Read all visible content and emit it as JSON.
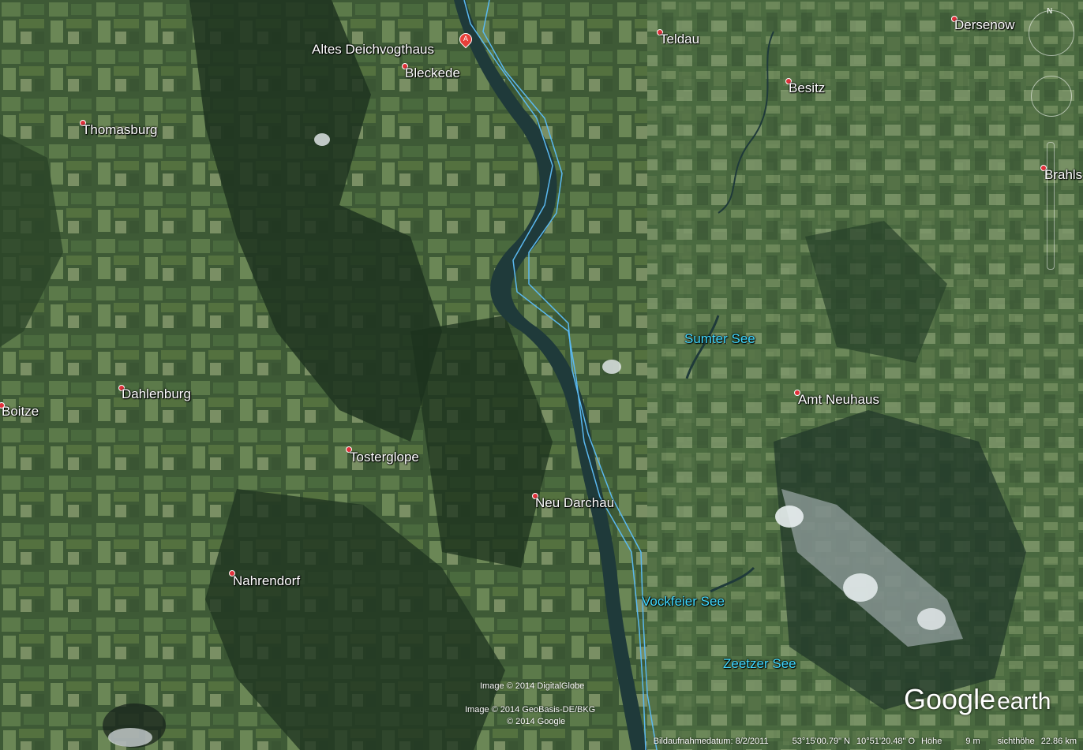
{
  "places": [
    {
      "id": "altes-deichvogthaus",
      "name": "Altes Deichvogthaus"
    },
    {
      "id": "bleckede",
      "name": "Bleckede"
    },
    {
      "id": "teldau",
      "name": "Teldau"
    },
    {
      "id": "dersenow",
      "name": "Dersenow"
    },
    {
      "id": "besitz",
      "name": "Besitz"
    },
    {
      "id": "thomasburg",
      "name": "Thomasburg"
    },
    {
      "id": "brahlstorf",
      "name": "Brahls"
    },
    {
      "id": "sumter-see",
      "name": "Sumter See"
    },
    {
      "id": "dahlenburg",
      "name": "Dahlenburg"
    },
    {
      "id": "boitze",
      "name": "Boitze"
    },
    {
      "id": "amt-neuhaus",
      "name": "Amt Neuhaus"
    },
    {
      "id": "tosterglope",
      "name": "Tosterglope"
    },
    {
      "id": "neu-darchau",
      "name": "Neu Darchau"
    },
    {
      "id": "nahrendorf",
      "name": "Nahrendorf"
    },
    {
      "id": "vockfeier-see",
      "name": "Vockfeier See"
    },
    {
      "id": "zeetzer-see",
      "name": "Zeetzer See"
    }
  ],
  "marker": {
    "letter": "A"
  },
  "credits": {
    "digitalglobe": "Image © 2014 DigitalGlobe",
    "geobasis": "Image © 2014 GeoBasis-DE/BKG",
    "google": "© 2014 Google"
  },
  "logo": {
    "google": "Google",
    "earth": "earth"
  },
  "status": {
    "date": "Bildaufnahmedatum: 8/2/2011",
    "lat": "53°15'00.79\" N",
    "lon": "10°51'20.48\" O",
    "elev_label": "Höhe",
    "elev_value": "9 m",
    "eye_label": "sichthöhe",
    "eye_value": "22.86 km"
  },
  "nav": {
    "north": "N"
  },
  "colors": {
    "river": "#1f3a3a",
    "boundary": "#5ab8f0",
    "water_label": "#3fd8ff"
  }
}
